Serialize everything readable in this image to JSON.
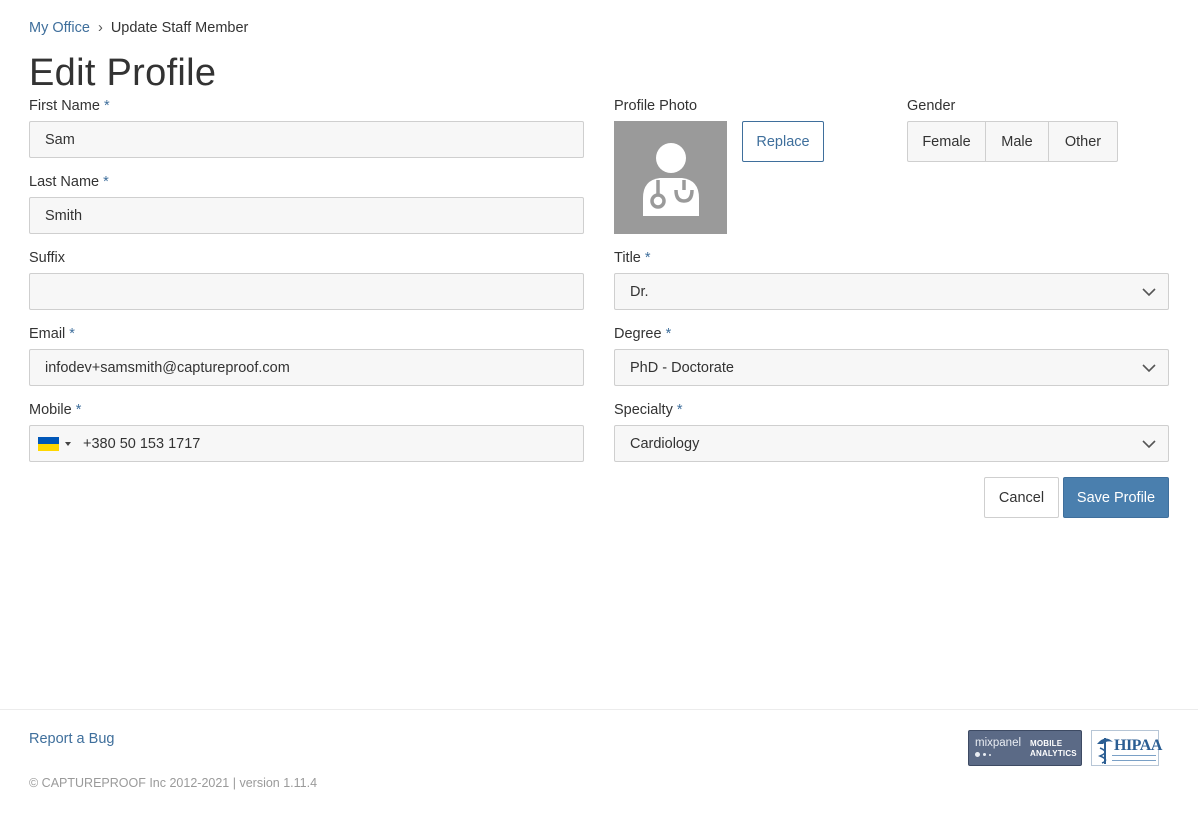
{
  "breadcrumb": {
    "home": "My Office",
    "separator": "›",
    "current": "Update Staff Member"
  },
  "page_title": "Edit Profile",
  "form": {
    "first_name": {
      "label": "First Name",
      "required_mark": "*",
      "value": "Sam"
    },
    "last_name": {
      "label": "Last Name",
      "required_mark": "*",
      "value": "Smith"
    },
    "suffix": {
      "label": "Suffix",
      "value": ""
    },
    "email": {
      "label": "Email",
      "required_mark": "*",
      "value": "infodev+samsmith@captureproof.com"
    },
    "mobile": {
      "label": "Mobile",
      "required_mark": "*",
      "value": "+380 50 153 1717",
      "country_flag": "ukraine-flag-icon"
    },
    "profile_photo": {
      "label": "Profile Photo",
      "replace_label": "Replace",
      "avatar_icon": "doctor-avatar-icon"
    },
    "gender": {
      "label": "Gender",
      "options": [
        "Female",
        "Male",
        "Other"
      ]
    },
    "title": {
      "label": "Title",
      "required_mark": "*",
      "value": "Dr."
    },
    "degree": {
      "label": "Degree",
      "required_mark": "*",
      "value": "PhD - Doctorate"
    },
    "specialty": {
      "label": "Specialty",
      "required_mark": "*",
      "value": "Cardiology"
    }
  },
  "actions": {
    "cancel_label": "Cancel",
    "save_label": "Save Profile"
  },
  "footer": {
    "report_bug": "Report a Bug",
    "copyright": "© CAPTUREPROOF Inc 2012-2021 | version 1.11.4",
    "mixpanel": {
      "brand": "mixpanel",
      "line1": "MOBILE",
      "line2": "ANALYTICS"
    },
    "hipaa": "HIPAA"
  },
  "colors": {
    "accent": "#3f6f9c",
    "save_bg": "#4a7fae",
    "field_bg": "#f7f7f7",
    "photo_bg": "#9a9a9a"
  }
}
